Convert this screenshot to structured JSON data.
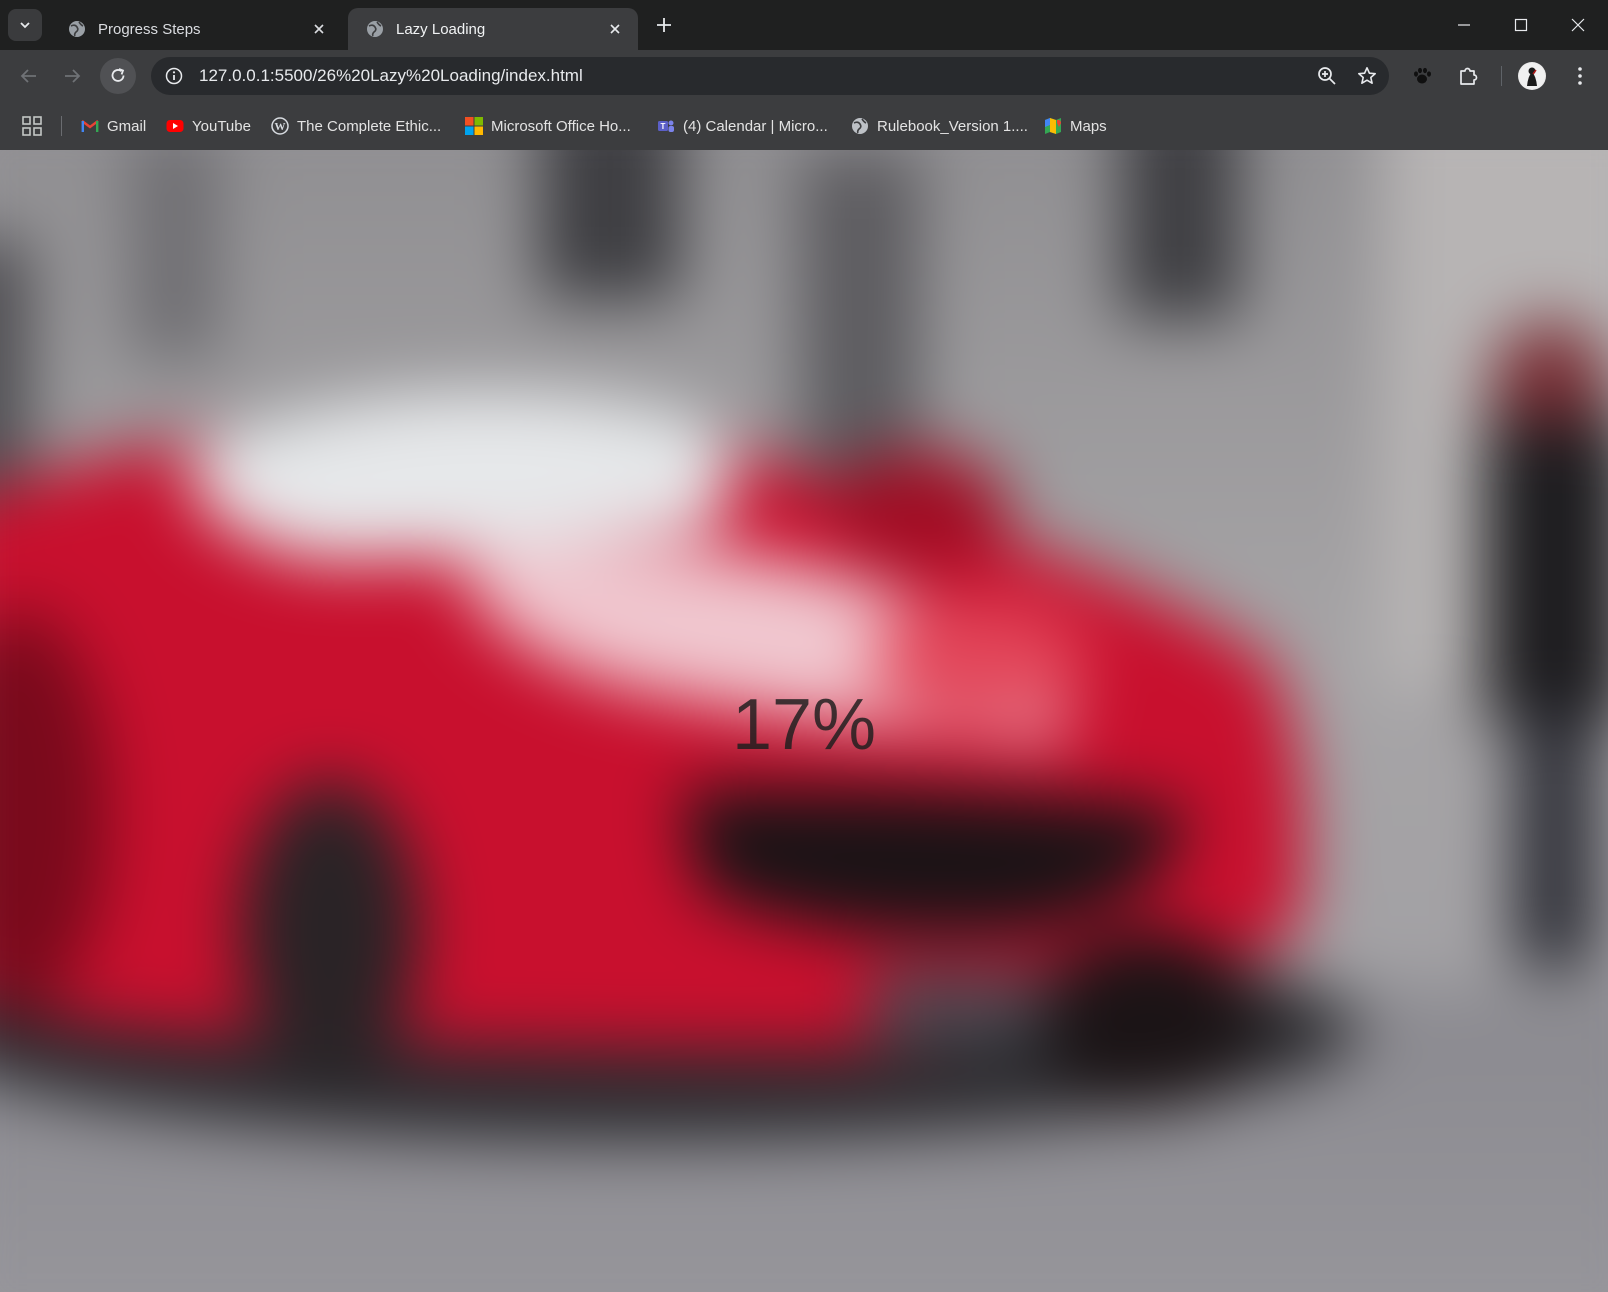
{
  "tabs": [
    {
      "title": "Progress Steps",
      "active": false
    },
    {
      "title": "Lazy Loading",
      "active": true
    }
  ],
  "toolbar": {
    "url": "127.0.0.1:5500/26%20Lazy%20Loading/index.html"
  },
  "bookmarks": [
    {
      "label": "Gmail",
      "icon": "gmail-icon"
    },
    {
      "label": "YouTube",
      "icon": "youtube-icon"
    },
    {
      "label": "The Complete Ethic...",
      "icon": "wordpress-icon"
    },
    {
      "label": "Microsoft Office Ho...",
      "icon": "microsoft-icon"
    },
    {
      "label": "(4) Calendar | Micro...",
      "icon": "teams-icon"
    },
    {
      "label": "Rulebook_Version 1....",
      "icon": "globe-icon"
    },
    {
      "label": "Maps",
      "icon": "maps-icon"
    }
  ],
  "page": {
    "loading_percent_text": "17%",
    "loading_progress": 0.17
  },
  "colors": {
    "tabstrip": "#1f2020",
    "toolbar": "#3c3d3f",
    "omnibox": "#282a2d",
    "car_red": "#c8102e"
  }
}
